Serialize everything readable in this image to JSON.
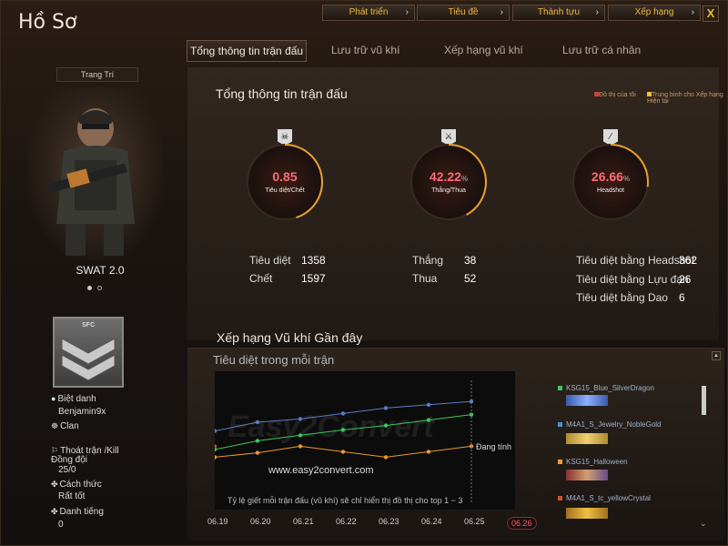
{
  "window": {
    "title": "Hồ Sơ",
    "close_label": "X"
  },
  "topnav": [
    {
      "label": "Phát triển",
      "arrow": "›"
    },
    {
      "label": "Tiêu đề",
      "arrow": "›"
    },
    {
      "label": "Thành tựu",
      "arrow": "›"
    },
    {
      "label": "Xếp hạng",
      "arrow": "›"
    }
  ],
  "tabs": [
    {
      "label": "Tổng thông tin trận đấu",
      "active": true
    },
    {
      "label": "Lưu trữ vũ khí",
      "active": false
    },
    {
      "label": "Xếp hạng vũ khí",
      "active": false
    },
    {
      "label": "Lưu trữ cá nhân",
      "active": false
    }
  ],
  "left": {
    "decorate_label": "Trang Trí",
    "character_name": "SWAT 2.0",
    "rank_badge_text": "SFC",
    "nickname_label": "Biệt danh",
    "nickname_value": "Benjamin9x",
    "clan_label": "Clan",
    "escape_label": "Thoát trận /Kill Đồng đội",
    "escape_value": "25/0",
    "style_label": "Cách thức",
    "style_value": "Rất tốt",
    "fame_label": "Danh tiếng",
    "fame_value": "0"
  },
  "overview": {
    "title": "Tổng thông tin trận đấu",
    "legend_mine": "Đồ thị của tôi",
    "legend_avg": "Trung bình cho Xếp hạng Hiện tại",
    "gauges": [
      {
        "value": "0.85",
        "unit": "",
        "label": "Tiêu diệt/Chết",
        "icon": "skull-icon",
        "fill": 0.45
      },
      {
        "value": "42.22",
        "unit": "%",
        "label": "Thắng/Thua",
        "icon": "crossed-swords-icon",
        "fill": 0.42
      },
      {
        "value": "26.66",
        "unit": "%",
        "label": "Headshot",
        "icon": "rifle-icon",
        "fill": 0.27
      }
    ],
    "stats_kd": [
      {
        "label": "Tiêu diệt",
        "value": "1358"
      },
      {
        "label": "Chết",
        "value": "1597"
      }
    ],
    "stats_wl": [
      {
        "label": "Thắng",
        "value": "38"
      },
      {
        "label": "Thua",
        "value": "52"
      }
    ],
    "stats_hs": [
      {
        "label": "Tiêu diệt bằng Headshot",
        "value": "362"
      },
      {
        "label": "Tiêu diệt bằng Lựu đạn",
        "value": "26"
      },
      {
        "label": "Tiêu diệt bằng Dao",
        "value": "6"
      }
    ]
  },
  "weapons": {
    "title": "Xếp hạng Vũ khí Gần đây",
    "subtitle": "Tiêu diệt trong mỗi trận",
    "note": "Tỷ lệ giết mỗi trận đấu (vũ khí) sẽ chỉ hiển thị đồ thị cho top 1 ~ 3",
    "current_label": "Đang tính",
    "watermark": "Easy2Convert",
    "watermark_url": "www.easy2convert.com",
    "selected_date": "06.26",
    "list": [
      {
        "name": "KSG15_Blue_SilverDragon",
        "color": "#3cc860"
      },
      {
        "name": "M4A1_S_Jewelry_NobleGold",
        "color": "#4a8fd8"
      },
      {
        "name": "KSG15_Halloween",
        "color": "#e8a030"
      },
      {
        "name": "M4A1_S_tc_yellowCrystal",
        "color": "#d05030"
      }
    ]
  },
  "chart_data": {
    "type": "line",
    "title": "Tiêu diệt trong mỗi trận",
    "x": [
      "06.19",
      "06.20",
      "06.21",
      "06.22",
      "06.23",
      "06.24",
      "06.25",
      "06.26"
    ],
    "ylim": [
      0,
      10
    ],
    "series": [
      {
        "values": [
          6.2,
          7.0,
          7.3,
          7.8,
          8.3,
          8.6,
          8.9
        ],
        "color": "#5a7cc8"
      },
      {
        "values": [
          4.5,
          5.3,
          5.8,
          6.3,
          6.7,
          7.2,
          7.7
        ],
        "color": "#3cc860"
      },
      {
        "values": [
          3.8,
          4.2,
          4.8,
          4.3,
          3.8,
          4.3,
          4.8
        ],
        "color": "#e89a30"
      },
      {
        "values": [
          4.8
        ],
        "color": "#d05030"
      }
    ]
  }
}
